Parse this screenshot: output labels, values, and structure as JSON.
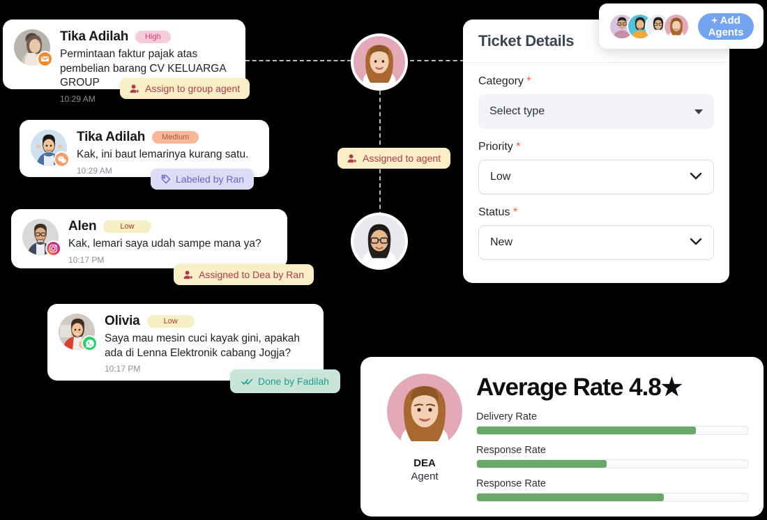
{
  "messages": [
    {
      "name": "Tika Adilah",
      "priority": "High",
      "text": "Permintaan faktur pajak atas pembelian barang CV KELUARGA GROUP",
      "time": "10:29 AM",
      "channel_icon": "email-icon"
    },
    {
      "name": "Tika Adilah",
      "priority": "Medium",
      "text": "Kak, ini baut lemarinya kurang satu.",
      "time": "10:29 AM",
      "channel_icon": "wechat-icon"
    },
    {
      "name": "Alen",
      "priority": "Low",
      "text": "Kak, lemari saya udah sampe mana ya?",
      "time": "10:17 PM",
      "channel_icon": "instagram-icon"
    },
    {
      "name": "Olivia",
      "priority": "Low",
      "text": "Saya mau mesin cuci kayak gini, apakah ada di Lenna Elektronik cabang Jogja?",
      "time": "10:17 PM",
      "channel_icon": "whatsapp-icon"
    }
  ],
  "chips": [
    {
      "label": "Assign to group agent",
      "icon": "assign-user-icon"
    },
    {
      "label": "Labeled by Ran",
      "icon": "tag-icon"
    },
    {
      "label": "Assigned to Dea by Ran",
      "icon": "assign-user-icon"
    },
    {
      "label": "Done by Fadilah",
      "icon": "double-check-icon"
    },
    {
      "label": "Assigned to agent",
      "icon": "assign-user-icon"
    }
  ],
  "ticket_details": {
    "title": "Ticket Details",
    "fields": [
      {
        "label": "Category",
        "required": "*",
        "value": "Select type",
        "style": "filled"
      },
      {
        "label": "Priority",
        "required": "*",
        "value": "Low",
        "style": "outline"
      },
      {
        "label": "Status",
        "required": "*",
        "value": "New",
        "style": "outline"
      }
    ]
  },
  "add_agents": {
    "button_label": "+ Add Agents",
    "avatar_count": 4
  },
  "rating": {
    "title": "Average Rate 4.8★",
    "agent_name": "DEA",
    "agent_role": "Agent",
    "bars": [
      {
        "label": "Delivery Rate",
        "percent": 81
      },
      {
        "label": "Response Rate",
        "percent": 48
      },
      {
        "label": "Response Rate",
        "percent": 69
      }
    ]
  },
  "colors": {
    "priority_high_bg": "#f6ccd8",
    "priority_high_text": "#e0396c",
    "priority_medium_bg": "#f9b79a",
    "priority_medium_text": "#a85a3a",
    "priority_low_bg": "#f6efc4",
    "priority_low_text": "#b03a2e",
    "chip_yellow_bg": "#f9eec4",
    "chip_yellow_text": "#b03a4e",
    "chip_lavender_bg": "#dcdcf7",
    "chip_lavender_text": "#6a63c9",
    "chip_mint_bg": "#c8e5d8",
    "chip_mint_text": "#1f9a94",
    "accent_blue": "#74a3f0",
    "bar_green": "#6aa869",
    "required_red": "#ff5630"
  }
}
